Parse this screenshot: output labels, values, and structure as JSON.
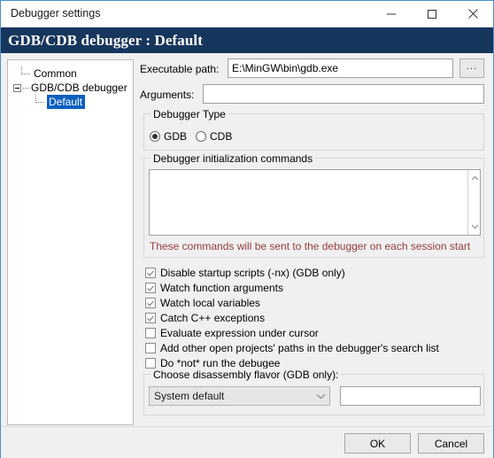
{
  "window": {
    "title": "Debugger settings",
    "controls": {
      "minimize": "minimize-icon",
      "maximize": "maximize-icon",
      "close": "close-icon"
    }
  },
  "header": {
    "title": "GDB/CDB debugger : Default",
    "background_color": "#17365d"
  },
  "tree": {
    "items": [
      {
        "label": "Common",
        "selected": false,
        "level": 1
      },
      {
        "label": "GDB/CDB debugger",
        "selected": false,
        "level": 0,
        "expander": "collapse-minus"
      },
      {
        "label": "Default",
        "selected": true,
        "level": 2
      }
    ],
    "selection_color": "#0a5fc0"
  },
  "form": {
    "executable_path": {
      "label": "Executable path:",
      "value": "E:\\MinGW\\bin\\gdb.exe",
      "placeholder": ""
    },
    "browse_button": "...",
    "arguments": {
      "label": "Arguments:",
      "value": "",
      "placeholder": ""
    }
  },
  "debugger_type": {
    "legend": "Debugger Type",
    "options": [
      {
        "label": "GDB",
        "selected": true
      },
      {
        "label": "CDB",
        "selected": false
      }
    ]
  },
  "init_commands": {
    "legend": "Debugger initialization commands",
    "value": "",
    "placeholder": "",
    "warning": "These commands will be sent to the debugger on each session start",
    "warning_color": "#9a3b3b"
  },
  "checkboxes": [
    {
      "label": "Disable startup scripts (-nx) (GDB only)",
      "checked": true
    },
    {
      "label": "Watch function arguments",
      "checked": true
    },
    {
      "label": "Watch local variables",
      "checked": true
    },
    {
      "label": "Catch C++ exceptions",
      "checked": true
    },
    {
      "label": "Evaluate expression under cursor",
      "checked": false
    },
    {
      "label": "Add other open projects' paths in the debugger's search list",
      "checked": false
    },
    {
      "label": "Do *not* run the debugee",
      "checked": false
    }
  ],
  "disassembly": {
    "legend": "Choose disassembly flavor (GDB only):",
    "selected": "System default",
    "options": [
      "System default"
    ],
    "extra_field_value": "",
    "extra_field_placeholder": ""
  },
  "footer": {
    "ok": "OK",
    "cancel": "Cancel"
  }
}
